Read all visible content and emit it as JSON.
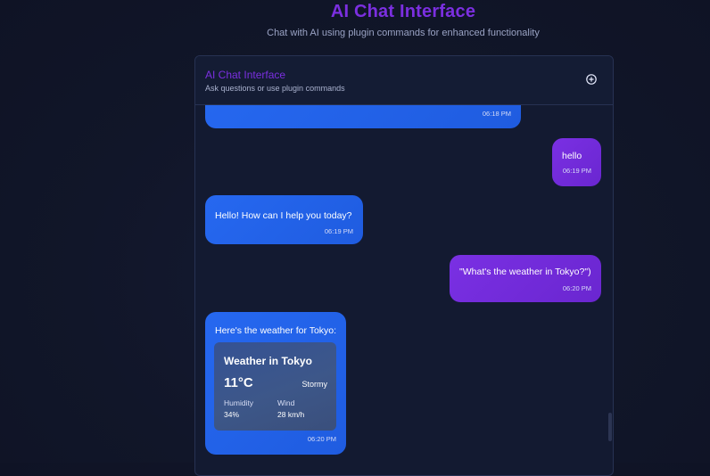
{
  "page": {
    "title": "AI Chat Interface",
    "subtitle": "Chat with AI using plugin commands for enhanced functionality"
  },
  "chat": {
    "header_title": "AI Chat Interface",
    "header_subtitle": "Ask questions or use plugin commands",
    "new_chat_icon": "plus-circle-icon"
  },
  "messages": [
    {
      "role": "assistant",
      "text": "",
      "time": "06:18 PM"
    },
    {
      "role": "user",
      "text": "hello",
      "time": "06:19 PM"
    },
    {
      "role": "assistant",
      "text": "Hello! How can I help you today?",
      "time": "06:19 PM"
    },
    {
      "role": "user",
      "text": "\"What's the weather in Tokyo?\")",
      "time": "06:20 PM"
    },
    {
      "role": "assistant",
      "text": "Here's the weather for Tokyo:",
      "time": "06:20 PM"
    }
  ],
  "weather": {
    "title": "Weather in Tokyo",
    "temperature": "11°C",
    "condition": "Stormy",
    "humidity_label": "Humidity",
    "humidity_value": "34%",
    "wind_label": "Wind",
    "wind_value": "28 km/h"
  },
  "colors": {
    "accent_purple": "#7b2fe0",
    "assistant_bubble": "#2668f0",
    "user_bubble": "#7a30e3",
    "background": "#111629"
  }
}
